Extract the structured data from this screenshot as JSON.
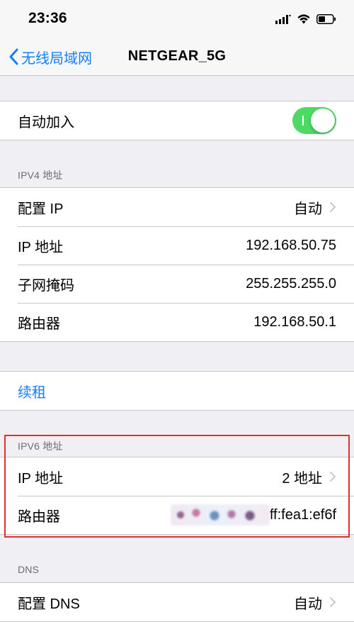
{
  "status_bar": {
    "time": "23:36"
  },
  "nav": {
    "back_label": "无线局域网",
    "title": "NETGEAR_5G"
  },
  "auto_join": {
    "label": "自动加入",
    "toggle_on": true
  },
  "ipv4": {
    "header": "IPV4 地址",
    "rows": [
      {
        "label": "配置 IP",
        "value": "自动"
      },
      {
        "label": "IP 地址",
        "value": "192.168.50.75"
      },
      {
        "label": "子网掩码",
        "value": "255.255.255.0"
      },
      {
        "label": "路由器",
        "value": "192.168.50.1"
      }
    ]
  },
  "renew": {
    "label": "续租"
  },
  "ipv6": {
    "header": "IPV6 地址",
    "rows": [
      {
        "label": "IP 地址",
        "value": "2 地址"
      },
      {
        "label": "路由器",
        "value_visible_suffix": "ff:fea1:ef6f"
      }
    ]
  },
  "dns": {
    "header": "DNS",
    "rows": [
      {
        "label": "配置 DNS",
        "value": "自动"
      }
    ]
  },
  "colors": {
    "accent": "#157efb",
    "toggle_on": "#4cd964",
    "background": "#efeff4",
    "highlight": "#e03131"
  }
}
